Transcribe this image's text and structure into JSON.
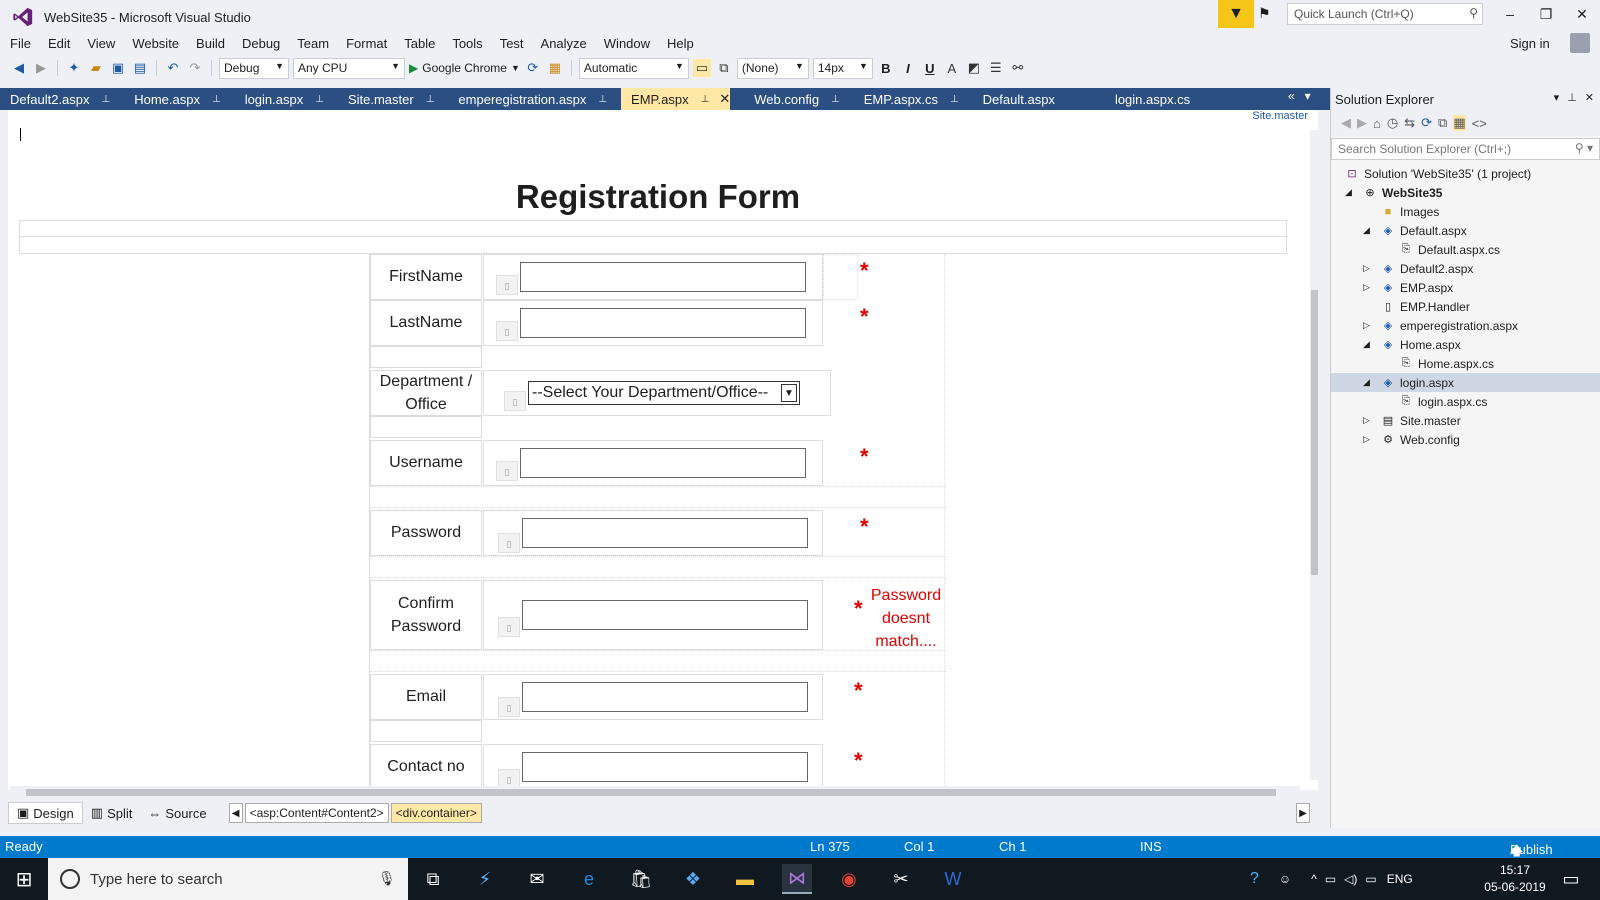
{
  "window": {
    "title": "WebSite35 - Microsoft Visual Studio",
    "quick_launch_placeholder": "Quick Launch (Ctrl+Q)",
    "sign_in": "Sign in"
  },
  "menu": [
    "File",
    "Edit",
    "View",
    "Website",
    "Build",
    "Debug",
    "Team",
    "Format",
    "Table",
    "Tools",
    "Test",
    "Analyze",
    "Window",
    "Help"
  ],
  "toolbar": {
    "config": "Debug",
    "platform": "Any CPU",
    "browser": "Google Chrome",
    "position": "Automatic",
    "style": "(None)",
    "font_size": "14px",
    "bold": "B",
    "italic": "I",
    "underline": "U"
  },
  "tabs": [
    {
      "label": "Default2.aspx",
      "active": false
    },
    {
      "label": "Home.aspx",
      "active": false
    },
    {
      "label": "login.aspx",
      "active": false
    },
    {
      "label": "Site.master",
      "active": false
    },
    {
      "label": "emperegistration.aspx",
      "active": false
    },
    {
      "label": "EMP.aspx",
      "active": true
    },
    {
      "label": "Web.config",
      "active": false
    },
    {
      "label": "EMP.aspx.cs",
      "active": false
    },
    {
      "label": "Default.aspx",
      "active": false
    },
    {
      "label": "login.aspx.cs",
      "active": false
    }
  ],
  "editor": {
    "master_link": "Site.master",
    "form_title": "Registration Form",
    "fields": {
      "firstname": "FirstName",
      "lastname": "LastName",
      "department": "Department / Office",
      "department_select": "--Select Your Department/Office--",
      "username": "Username",
      "password": "Password",
      "confirm": "Confirm Password",
      "email": "Email",
      "contact": "Contact no"
    },
    "required_mark": "*",
    "mismatch_error": "Password doesnt match...."
  },
  "viewbar": {
    "design": "Design",
    "split": "Split",
    "source": "Source",
    "crumb1": "<asp:Content#Content2>",
    "crumb2": "<div.container>"
  },
  "solution_explorer": {
    "title": "Solution Explorer",
    "search_placeholder": "Search Solution Explorer (Ctrl+;)",
    "tree": [
      {
        "label": "Solution 'WebSite35' (1 project)",
        "level": 0,
        "exp": "",
        "icon": "solution-icon"
      },
      {
        "label": "WebSite35",
        "level": 0,
        "exp": "open",
        "icon": "globe-icon",
        "bold": true
      },
      {
        "label": "Images",
        "level": 1,
        "exp": "",
        "icon": "folder-icon"
      },
      {
        "label": "Default.aspx",
        "level": 1,
        "exp": "open",
        "icon": "aspx-icon"
      },
      {
        "label": "Default.aspx.cs",
        "level": 2,
        "exp": "",
        "icon": "cs-icon"
      },
      {
        "label": "Default2.aspx",
        "level": 1,
        "exp": "closed",
        "icon": "aspx-icon"
      },
      {
        "label": "EMP.aspx",
        "level": 1,
        "exp": "closed",
        "icon": "aspx-icon"
      },
      {
        "label": "EMP.Handler",
        "level": 1,
        "exp": "",
        "icon": "file-icon"
      },
      {
        "label": "emperegistration.aspx",
        "level": 1,
        "exp": "closed",
        "icon": "aspx-icon"
      },
      {
        "label": "Home.aspx",
        "level": 1,
        "exp": "open",
        "icon": "aspx-icon"
      },
      {
        "label": "Home.aspx.cs",
        "level": 2,
        "exp": "",
        "icon": "cs-icon"
      },
      {
        "label": "login.aspx",
        "level": 1,
        "exp": "open",
        "icon": "aspx-icon",
        "selected": true
      },
      {
        "label": "login.aspx.cs",
        "level": 2,
        "exp": "",
        "icon": "cs-icon"
      },
      {
        "label": "Site.master",
        "level": 1,
        "exp": "closed",
        "icon": "master-icon"
      },
      {
        "label": "Web.config",
        "level": 1,
        "exp": "closed",
        "icon": "config-icon"
      }
    ]
  },
  "status": {
    "state": "Ready",
    "line": "Ln 375",
    "col": "Col 1",
    "ch": "Ch 1",
    "mode": "INS",
    "publish": "Publish"
  },
  "taskbar": {
    "search_placeholder": "Type here to search",
    "lang": "ENG",
    "time": "15:17",
    "date": "05-06-2019"
  }
}
